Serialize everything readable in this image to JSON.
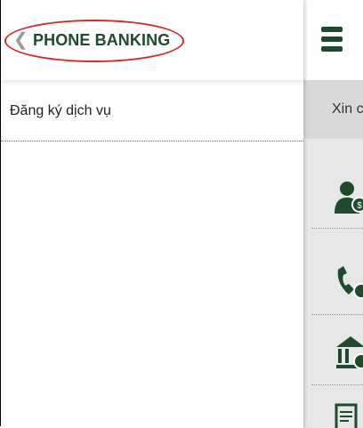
{
  "drawer": {
    "title": "PHONE BANKING",
    "items": [
      {
        "label": "Đăng ký dịch vụ"
      }
    ]
  },
  "right_panel": {
    "greeting": "Xin c"
  },
  "colors": {
    "brand_green": "#1f4a2e",
    "highlight_red": "#d62b2b"
  },
  "icons": [
    "user-money-icon",
    "phone-money-icon",
    "bank-money-icon",
    "document-icon"
  ]
}
